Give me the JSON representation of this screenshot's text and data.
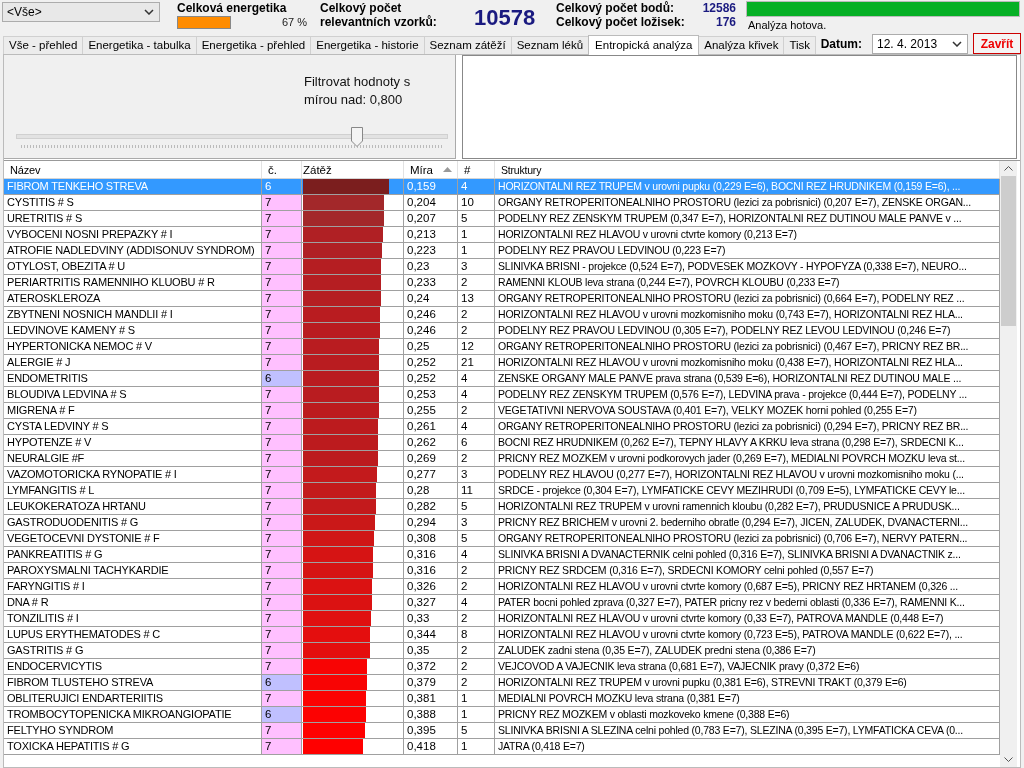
{
  "filter_combo": {
    "value": "<Vše>"
  },
  "energy": {
    "label": "Celková energetika",
    "level": 1,
    "percent": "67 %"
  },
  "samples": {
    "label": "Celkový počet relevantních vzorků:",
    "value": "10578"
  },
  "points": {
    "label": "Celkový počet bodů:",
    "value": "12586"
  },
  "foci": {
    "label": "Celkový počet ložisek:",
    "value": "176"
  },
  "progress": {
    "level": 1,
    "status": "Analýza hotova."
  },
  "tabs": [
    {
      "label": "Vše - přehled",
      "selected": false
    },
    {
      "label": "Energetika - tabulka",
      "selected": false
    },
    {
      "label": "Energetika - přehled",
      "selected": false
    },
    {
      "label": "Energetika - historie",
      "selected": false
    },
    {
      "label": "Seznam zátěží",
      "selected": false
    },
    {
      "label": "Seznam léků",
      "selected": false
    },
    {
      "label": "Entropická analýza",
      "selected": true
    },
    {
      "label": "Analýza křivek",
      "selected": false
    },
    {
      "label": "Tisk",
      "selected": false
    }
  ],
  "date": {
    "label": "Datum:",
    "value": "12. 4. 2013"
  },
  "close_button": "Zavřít",
  "filter": {
    "label": "Filtrovat hodnoty s mírou nad: 0,800",
    "level": 0.79
  },
  "table": {
    "columns": [
      "Název",
      "č.",
      "Zátěž",
      "Míra",
      "#",
      "Struktury"
    ],
    "rows": [
      {
        "name": "FIBROM TENKEHO STREVA",
        "num": {
          "text": "6"
        },
        "load": {
          "level": 0.86,
          "color": "#7b1e1e"
        },
        "mira": "0,159",
        "count": "4",
        "struct": "HORIZONTALNI REZ TRUPEM v urovni pupku (0,229 E=6), BOCNI REZ HRUDNIKEM (0,159 E=6), ...",
        "selected": true
      },
      {
        "name": "CYSTITIS # S",
        "num": {
          "text": "7",
          "color": "#ffc0ff"
        },
        "load": {
          "level": 0.81,
          "color": "#a3282a"
        },
        "mira": "0,204",
        "count": "10",
        "struct": "ORGANY RETROPERITONEALNIHO PROSTORU (lezici za pobrisnici) (0,207 E=7), ZENSKE ORGAN...",
        "selected": false
      },
      {
        "name": "URETRITIS # S",
        "num": {
          "text": "7",
          "color": "#ffc0ff"
        },
        "load": {
          "level": 0.81,
          "color": "#a3282a"
        },
        "mira": "0,207",
        "count": "5",
        "struct": "PODELNY REZ ZENSKYM TRUPEM (0,347 E=7), HORIZONTALNI REZ DUTINOU MALE PANVE v ...",
        "selected": false
      },
      {
        "name": "VYBOCENI NOSNI PREPAZKY # I",
        "num": {
          "text": "7",
          "color": "#ffc0ff"
        },
        "load": {
          "level": 0.8,
          "color": "#b02024"
        },
        "mira": "0,213",
        "count": "1",
        "struct": "HORIZONTALNI REZ HLAVOU v urovni ctvrte komory (0,213 E=7)",
        "selected": false
      },
      {
        "name": "ATROFIE NADLEDVINY (ADDISONUV SYNDROM)",
        "num": {
          "text": "7",
          "color": "#ffc0ff"
        },
        "load": {
          "level": 0.79,
          "color": "#b02024"
        },
        "mira": "0,223",
        "count": "1",
        "struct": "PODELNY REZ PRAVOU LEDVINOU (0,223 E=7)",
        "selected": false
      },
      {
        "name": "OTYLOST, OBEZITA # U",
        "num": {
          "text": "7",
          "color": "#ffc0ff"
        },
        "load": {
          "level": 0.78,
          "color": "#b51e22"
        },
        "mira": "0,23",
        "count": "3",
        "struct": "SLINIVKA BRISNI - projekce (0,524 E=7), PODVESEK MOZKOVY - HYPOFYZA (0,338 E=7), NEURO...",
        "selected": false
      },
      {
        "name": "PERIARTRITIS RAMENNIHO KLUOBU # R",
        "num": {
          "text": "7",
          "color": "#ffc0ff"
        },
        "load": {
          "level": 0.78,
          "color": "#b51e22"
        },
        "mira": "0,233",
        "count": "2",
        "struct": "RAMENNI KLOUB leva strana (0,244 E=7), POVRCH KLOUBU (0,233 E=7)",
        "selected": false
      },
      {
        "name": "ATEROSKLEROZA",
        "num": {
          "text": "7",
          "color": "#ffc0ff"
        },
        "load": {
          "level": 0.78,
          "color": "#b51e22"
        },
        "mira": "0,24",
        "count": "13",
        "struct": "ORGANY RETROPERITONEALNIHO PROSTORU (lezici za pobrisnici) (0,664 E=7), PODELNY REZ ...",
        "selected": false
      },
      {
        "name": "ZBYTNENI NOSNICH MANDLII # I",
        "num": {
          "text": "7",
          "color": "#ffc0ff"
        },
        "load": {
          "level": 0.77,
          "color": "#b91c20"
        },
        "mira": "0,246",
        "count": "2",
        "struct": "HORIZONTALNI REZ HLAVOU v urovni mozkomisniho moku (0,743 E=7), HORIZONTALNI REZ HLA...",
        "selected": false
      },
      {
        "name": "LEDVINOVE KAMENY # S",
        "num": {
          "text": "7",
          "color": "#ffc0ff"
        },
        "load": {
          "level": 0.77,
          "color": "#b91c20"
        },
        "mira": "0,246",
        "count": "2",
        "struct": "PODELNY REZ PRAVOU LEDVINOU (0,305 E=7), PODELNY REZ LEVOU LEDVINOU (0,246 E=7)",
        "selected": false
      },
      {
        "name": "HYPERTONICKA NEMOC # V",
        "num": {
          "text": "7",
          "color": "#ffc0ff"
        },
        "load": {
          "level": 0.76,
          "color": "#b91c20"
        },
        "mira": "0,25",
        "count": "12",
        "struct": "ORGANY RETROPERITONEALNIHO PROSTORU (lezici za pobrisnici) (0,467 E=7), PRICNY REZ BR...",
        "selected": false
      },
      {
        "name": "ALERGIE # J",
        "num": {
          "text": "7",
          "color": "#ffc0ff"
        },
        "load": {
          "level": 0.76,
          "color": "#b91c20"
        },
        "mira": "0,252",
        "count": "21",
        "struct": "HORIZONTALNI REZ HLAVOU v urovni mozkomisniho moku (0,438 E=7), HORIZONTALNI REZ HLA...",
        "selected": false
      },
      {
        "name": "ENDOMETRITIS",
        "num": {
          "text": "6",
          "color": "#c0c0ff"
        },
        "load": {
          "level": 0.76,
          "color": "#b91c20"
        },
        "mira": "0,252",
        "count": "4",
        "struct": "ZENSKE ORGANY MALE PANVE prava strana (0,539 E=6), HORIZONTALNI REZ DUTINOU MALE ...",
        "selected": false
      },
      {
        "name": "BLOUDIVA LEDVINA # S",
        "num": {
          "text": "7",
          "color": "#ffc0ff"
        },
        "load": {
          "level": 0.76,
          "color": "#b91c20"
        },
        "mira": "0,253",
        "count": "4",
        "struct": "PODELNY REZ ZENSKYM TRUPEM (0,576 E=7), LEDVINA prava - projekce (0,444 E=7), PODELNY ...",
        "selected": false
      },
      {
        "name": "MIGRENA # F",
        "num": {
          "text": "7",
          "color": "#ffc0ff"
        },
        "load": {
          "level": 0.76,
          "color": "#bc1b1e"
        },
        "mira": "0,255",
        "count": "2",
        "struct": "VEGETATIVNI NERVOVA SOUSTAVA (0,401 E=7), VELKY MOZEK horni pohled (0,255 E=7)",
        "selected": false
      },
      {
        "name": "CYSTA LEDVINY # S",
        "num": {
          "text": "7",
          "color": "#ffc0ff"
        },
        "load": {
          "level": 0.75,
          "color": "#bc1b1e"
        },
        "mira": "0,261",
        "count": "4",
        "struct": "ORGANY RETROPERITONEALNIHO PROSTORU (lezici za pobrisnici) (0,294 E=7), PRICNY REZ BR...",
        "selected": false
      },
      {
        "name": "HYPOTENZE # V",
        "num": {
          "text": "7",
          "color": "#ffc0ff"
        },
        "load": {
          "level": 0.75,
          "color": "#bc1b1e"
        },
        "mira": "0,262",
        "count": "6",
        "struct": "BOCNI REZ HRUDNIKEM (0,262 E=7), TEPNY HLAVY A KRKU leva strana (0,298 E=7), SRDECNI K...",
        "selected": false
      },
      {
        "name": "NEURALGIE #F",
        "num": {
          "text": "7",
          "color": "#ffc0ff"
        },
        "load": {
          "level": 0.75,
          "color": "#bc1b1e"
        },
        "mira": "0,269",
        "count": "2",
        "struct": "PRICNY REZ MOZKEM v urovni podkorovych jader (0,269 E=7), MEDIALNI POVRCH MOZKU leva st...",
        "selected": false
      },
      {
        "name": "VAZOMOTORICKA RYNOPATIE # I",
        "num": {
          "text": "7",
          "color": "#ffc0ff"
        },
        "load": {
          "level": 0.74,
          "color": "#c31a1c"
        },
        "mira": "0,277",
        "count": "3",
        "struct": "PODELNY REZ HLAVOU (0,277 E=7), HORIZONTALNI REZ HLAVOU v urovni mozkomisniho moku (...",
        "selected": false
      },
      {
        "name": "LYMFANGITIS # L",
        "num": {
          "text": "7",
          "color": "#ffc0ff"
        },
        "load": {
          "level": 0.73,
          "color": "#c31a1c"
        },
        "mira": "0,28",
        "count": "11",
        "struct": "SRDCE - projekce (0,304 E=7), LYMFATICKE CEVY MEZIHRUDI (0,709 E=5), LYMFATICKE CEVY le...",
        "selected": false
      },
      {
        "name": "LEUKOKERATOZA HRTANU",
        "num": {
          "text": "7",
          "color": "#ffc0ff"
        },
        "load": {
          "level": 0.73,
          "color": "#c31a1c"
        },
        "mira": "0,282",
        "count": "5",
        "struct": "HORIZONTALNI REZ TRUPEM v urovni ramennich kloubu (0,282 E=7), PRUDUSNICE A PRUDUSK...",
        "selected": false
      },
      {
        "name": "GASTRODUODENITIS # G",
        "num": {
          "text": "7",
          "color": "#ffc0ff"
        },
        "load": {
          "level": 0.72,
          "color": "#ca1818"
        },
        "mira": "0,294",
        "count": "3",
        "struct": "PRICNY REZ BRICHEM v urovni 2. bederniho obratle (0,294 E=7), JICEN, ZALUDEK, DVANACTERNI...",
        "selected": false
      },
      {
        "name": "VEGETOCEVNI DYSTONIE # F",
        "num": {
          "text": "7",
          "color": "#ffc0ff"
        },
        "load": {
          "level": 0.71,
          "color": "#d01616"
        },
        "mira": "0,308",
        "count": "5",
        "struct": "ORGANY RETROPERITONEALNIHO PROSTORU (lezici za pobrisnici) (0,706 E=7), NERVY PATERN...",
        "selected": false
      },
      {
        "name": "PANKREATITIS # G",
        "num": {
          "text": "7",
          "color": "#ffc0ff"
        },
        "load": {
          "level": 0.7,
          "color": "#d61414"
        },
        "mira": "0,316",
        "count": "4",
        "struct": "SLINIVKA BRISNI A DVANACTERNIK celni pohled (0,316 E=7), SLINIVKA BRISNI A DVANACTNIK  z...",
        "selected": false
      },
      {
        "name": "PAROXYSMALNI TACHYKARDIE",
        "num": {
          "text": "7",
          "color": "#ffc0ff"
        },
        "load": {
          "level": 0.7,
          "color": "#d61414"
        },
        "mira": "0,316",
        "count": "2",
        "struct": "PRICNY REZ SRDCEM (0,316 E=7), SRDECNI KOMORY celni pohled (0,557 E=7)",
        "selected": false
      },
      {
        "name": "FARYNGITIS # I",
        "num": {
          "text": "7",
          "color": "#ffc0ff"
        },
        "load": {
          "level": 0.69,
          "color": "#db1212"
        },
        "mira": "0,326",
        "count": "2",
        "struct": "HORIZONTALNI REZ HLAVOU v urovni ctvrte komory (0,687 E=5), PRICNY REZ HRTANEM (0,326 ...",
        "selected": false
      },
      {
        "name": "DNA # R",
        "num": {
          "text": "7",
          "color": "#ffc0ff"
        },
        "load": {
          "level": 0.69,
          "color": "#db1212"
        },
        "mira": "0,327",
        "count": "4",
        "struct": "PATER bocni pohled zprava (0,327 E=7), PATER pricny rez v bederni oblasti (0,336 E=7), RAMENNI K...",
        "selected": false
      },
      {
        "name": "TONZILITIS # I",
        "num": {
          "text": "7",
          "color": "#ffc0ff"
        },
        "load": {
          "level": 0.68,
          "color": "#e01010"
        },
        "mira": "0,33",
        "count": "2",
        "struct": "HORIZONTALNI REZ HLAVOU v urovni ctvrte komory (0,33 E=7), PATROVA MANDLE (0,448 E=7)",
        "selected": false
      },
      {
        "name": "LUPUS ERYTHEMATODES # C",
        "num": {
          "text": "7",
          "color": "#ffc0ff"
        },
        "load": {
          "level": 0.67,
          "color": "#e40e0e"
        },
        "mira": "0,344",
        "count": "8",
        "struct": "HORIZONTALNI REZ HLAVOU v urovni ctvrte komory (0,723 E=5), PATROVA MANDLE (0,622 E=7), ...",
        "selected": false
      },
      {
        "name": "GASTRITIS # G",
        "num": {
          "text": "7",
          "color": "#ffc0ff"
        },
        "load": {
          "level": 0.67,
          "color": "#e40e0e"
        },
        "mira": "0,35",
        "count": "2",
        "struct": "ZALUDEK zadni stena (0,35 E=7), ZALUDEK predni stena (0,386 E=7)",
        "selected": false
      },
      {
        "name": "ENDOCERVICYTIS",
        "num": {
          "text": "7",
          "color": "#ffc0ff"
        },
        "load": {
          "level": 0.64,
          "color": "#f80404"
        },
        "mira": "0,372",
        "count": "2",
        "struct": "VEJCOVOD A VAJECNIK leva strana (0,681 E=7), VAJECNIK pravy (0,372 E=6)",
        "selected": false
      },
      {
        "name": "FIBROM TLUSTEHO STREVA",
        "num": {
          "text": "6",
          "color": "#c0c0ff"
        },
        "load": {
          "level": 0.64,
          "color": "#f80404"
        },
        "mira": "0,379",
        "count": "2",
        "struct": "HORIZONTALNI REZ TRUPEM v urovni pupku (0,381 E=6), STREVNI TRAKT (0,379 E=6)",
        "selected": false
      },
      {
        "name": "OBLITERUJICI ENDARTERIITIS",
        "num": {
          "text": "7",
          "color": "#ffc0ff"
        },
        "load": {
          "level": 0.63,
          "color": "#fc0202"
        },
        "mira": "0,381",
        "count": "1",
        "struct": "MEDIALNI POVRCH MOZKU leva strana (0,381 E=7)",
        "selected": false
      },
      {
        "name": "TROMBOCYTOPENICKA  MIKROANGIOPATIE",
        "num": {
          "text": "6",
          "color": "#c0c0ff"
        },
        "load": {
          "level": 0.63,
          "color": "#fc0202"
        },
        "mira": "0,388",
        "count": "1",
        "struct": "PRICNY REZ MOZKEM v oblasti mozkoveko kmene (0,388 E=6)",
        "selected": false
      },
      {
        "name": "FELTYHO SYNDROM",
        "num": {
          "text": "7",
          "color": "#ffc0ff"
        },
        "load": {
          "level": 0.62,
          "color": "#ff0000"
        },
        "mira": "0,395",
        "count": "5",
        "struct": "SLINIVKA BRISNI A SLEZINA celni pohled (0,783 E=7), SLEZINA (0,395 E=7), LYMFATICKA CEVA (0...",
        "selected": false
      },
      {
        "name": "TOXICKA HEPATITIS   # G",
        "num": {
          "text": "7",
          "color": "#ffc0ff"
        },
        "load": {
          "level": 0.6,
          "color": "#ff0000"
        },
        "mira": "0,418",
        "count": "1",
        "struct": "JATRA (0,418 E=7)",
        "selected": false
      }
    ]
  }
}
